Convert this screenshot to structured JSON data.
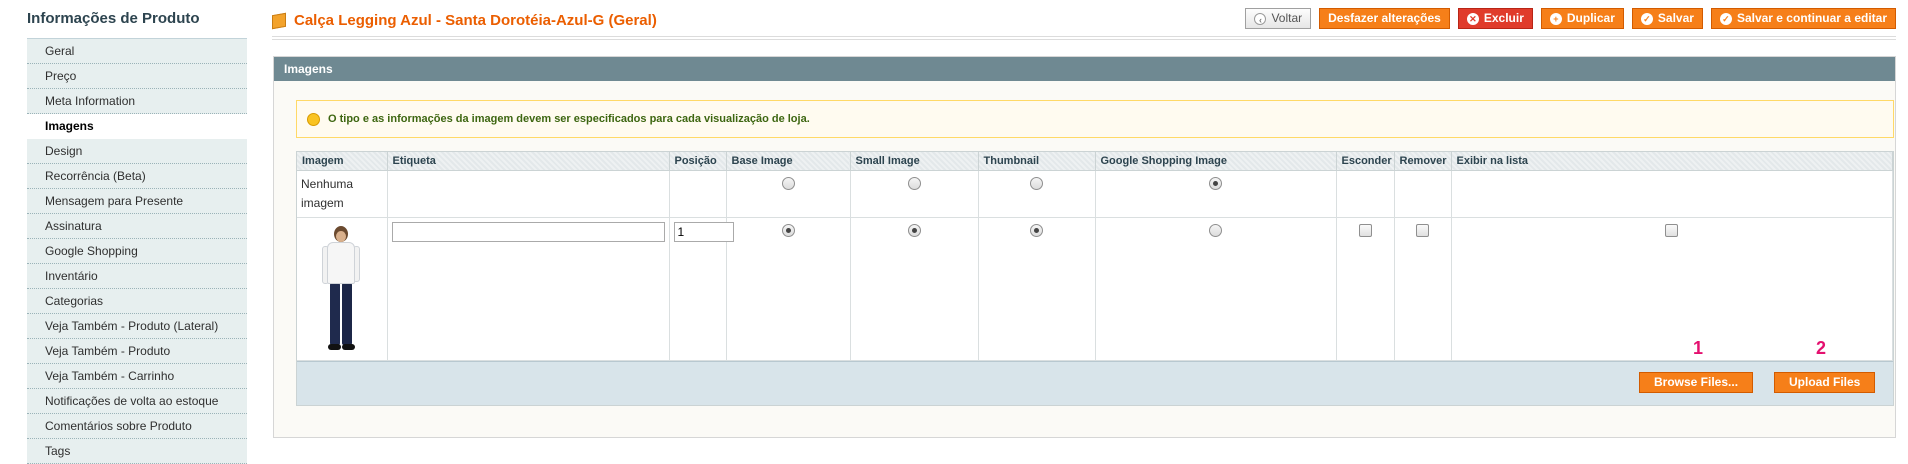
{
  "sidebar": {
    "title": "Informações de Produto",
    "items": [
      {
        "label": "Geral"
      },
      {
        "label": "Preço"
      },
      {
        "label": "Meta Information"
      },
      {
        "label": "Imagens",
        "active": true
      },
      {
        "label": "Design"
      },
      {
        "label": "Recorrência (Beta)"
      },
      {
        "label": "Mensagem para Presente"
      },
      {
        "label": "Assinatura"
      },
      {
        "label": "Google Shopping"
      },
      {
        "label": "Inventário"
      },
      {
        "label": "Categorias"
      },
      {
        "label": "Veja Também - Produto (Lateral)"
      },
      {
        "label": "Veja Também - Produto"
      },
      {
        "label": "Veja Também - Carrinho"
      },
      {
        "label": "Notificações de volta ao estoque"
      },
      {
        "label": "Comentários sobre Produto"
      },
      {
        "label": "Tags"
      }
    ]
  },
  "header": {
    "title": "Calça Legging Azul - Santa Dorotéia-Azul-G (Geral)",
    "icon": "product-box-icon",
    "buttons": {
      "back": "Voltar",
      "reset": "Desfazer alterações",
      "delete": "Excluir",
      "duplicate": "Duplicar",
      "save": "Salvar",
      "save_continue": "Salvar e continuar a editar"
    }
  },
  "images_section": {
    "title": "Imagens",
    "notice": "O tipo e as informações da imagem devem ser especificados para cada visualização de loja.",
    "columns": {
      "image": "Imagem",
      "label": "Etiqueta",
      "position": "Posição",
      "base": "Base Image",
      "small": "Small Image",
      "thumb": "Thumbnail",
      "google": "Google Shopping Image",
      "hide": "Esconder",
      "remove": "Remover",
      "list": "Exibir na lista"
    },
    "no_image_row": {
      "label": "Nenhuma imagem",
      "base_checked": false,
      "small_checked": false,
      "thumb_checked": false,
      "google_checked": true
    },
    "image_row": {
      "etiqueta": "",
      "position": "1",
      "base_checked": true,
      "small_checked": true,
      "thumb_checked": true,
      "google_checked": false
    },
    "browse_button": "Browse Files...",
    "upload_button": "Upload Files",
    "marker_1": "1",
    "marker_2": "2"
  },
  "colors": {
    "accent": "#f67f19",
    "title": "#eb5e00",
    "section_head": "#6f8992"
  }
}
